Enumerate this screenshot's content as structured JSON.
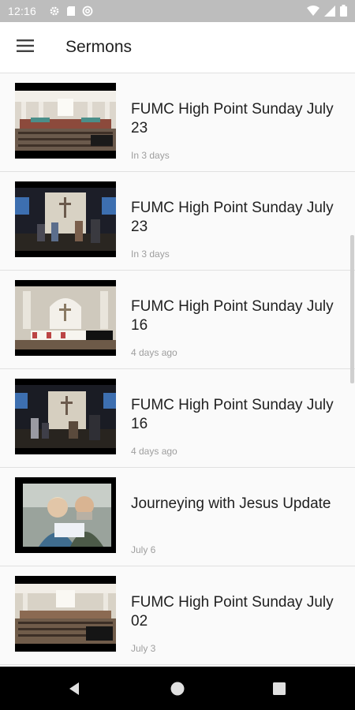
{
  "status_bar": {
    "time": "12:16",
    "icons": [
      "gear-icon",
      "sd-card-icon",
      "sync-icon",
      "wifi-icon",
      "signal-icon",
      "battery-icon"
    ]
  },
  "app_bar": {
    "menu_icon": "hamburger-menu-icon",
    "title": "Sermons"
  },
  "sermons": [
    {
      "title": "FUMC High Point Sunday July 23",
      "date": "In 3 days",
      "thumbnail": "sanctuary-wide-thumbnail"
    },
    {
      "title": "FUMC High Point Sunday July 23",
      "date": "In 3 days",
      "thumbnail": "contemporary-stage-thumbnail"
    },
    {
      "title": "FUMC High Point Sunday July 16",
      "date": "4 days ago",
      "thumbnail": "sanctuary-altar-thumbnail"
    },
    {
      "title": "FUMC High Point Sunday July 16",
      "date": "4 days ago",
      "thumbnail": "contemporary-stage-thumbnail"
    },
    {
      "title": "Journeying with Jesus Update",
      "date": "July 6",
      "thumbnail": "couple-video-thumbnail"
    },
    {
      "title": "FUMC High Point Sunday July 02",
      "date": "July 3",
      "thumbnail": "sanctuary-wide-thumbnail"
    }
  ],
  "nav_bar": {
    "icons": [
      "back-icon",
      "home-icon",
      "recents-icon"
    ]
  },
  "colors": {
    "status_bar": "#bdbdbd",
    "app_bar": "#ffffff",
    "list_background": "#fafafa",
    "divider": "#e0e0e0",
    "date_text": "#9e9e9e",
    "nav_bar": "#000000"
  }
}
